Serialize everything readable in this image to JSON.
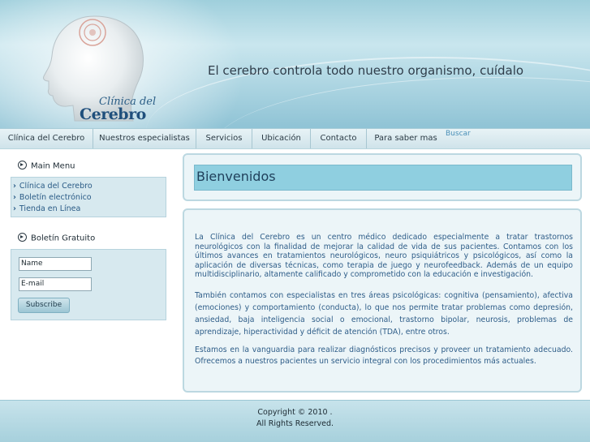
{
  "header": {
    "logo_small": "Clínica del",
    "logo_large": "Cerebro",
    "tagline": "El cerebro controla todo nuestro organismo, cuídalo"
  },
  "nav": {
    "items": [
      "Clínica del Cerebro",
      "Nuestros especialistas",
      "Servicios",
      "Ubicación",
      "Contacto",
      "Para saber mas"
    ],
    "search_label": "Buscar"
  },
  "sidebar": {
    "main_menu_title": "Main Menu",
    "links": [
      "Clínica del Cerebro",
      "Boletín electrónico",
      "Tienda en Línea"
    ],
    "newsletter_title": "Boletín Gratuito",
    "name_value": "Name",
    "email_value": "E-mail",
    "subscribe_label": "Subscribe"
  },
  "main": {
    "welcome_title": "Bienvenidos",
    "paragraphs": [
      "La Clínica del Cerebro es un centro médico dedicado especialmente a tratar trastornos neurológicos con la finalidad de mejorar la calidad de vida de sus pacientes. Contamos con los últimos avances en tratamientos neurológicos, neuro psiquiátricos y psicológicos, así como la aplicación de diversas técnicas, como terapia de juego y neurofeedback. Además de un equipo multidisciplinario, altamente calificado y comprometido con la educación e investigación.",
      "También contamos con especialistas en tres áreas psicológicas: cognitiva (pensamiento), afectiva (emociones) y comportamiento (conducta), lo que nos permite tratar problemas como depresión, ansiedad, baja inteligencia social o emocional, trastorno bipolar, neurosis, problemas de aprendizaje, hiperactividad y déficit de atención (TDA), entre otros.",
      "Estamos en la vanguardia para realizar diagnósticos precisos y proveer un tratamiento adecuado. Ofrecemos a nuestros pacientes un servicio integral con los procedimientos más actuales."
    ]
  },
  "footer": {
    "copyright": "Copyright © 2010 .",
    "rights": "All Rights Reserved."
  },
  "colors": {
    "header": "#9fcfdc",
    "accent_text": "#2e5d88",
    "panel_title_bg": "#8fcfe0"
  }
}
